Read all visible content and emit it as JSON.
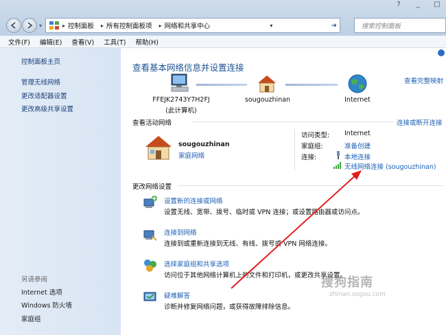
{
  "window": {
    "controls": [
      "?",
      "_",
      "□"
    ]
  },
  "address": {
    "crumbs": [
      "控制面板",
      "所有控制面板项",
      "网络和共享中心"
    ],
    "search_placeholder": "搜索控制面板"
  },
  "menu": [
    "文件(F)",
    "编辑(E)",
    "查看(V)",
    "工具(T)",
    "帮助(H)"
  ],
  "sidebar": {
    "home": "控制面板主页",
    "items": [
      "管理无线网络",
      "更改适配器设置",
      "更改高级共享设置"
    ],
    "see_also_heading": "另请参阅",
    "see_also": [
      "Internet 选项",
      "Windows 防火墙",
      "家庭组"
    ]
  },
  "main": {
    "title": "查看基本网络信息并设置连接",
    "full_map": "查看完整映射",
    "map": {
      "computer_name": "FFEJK2743Y7H2FJ",
      "computer_sub": "(此计算机)",
      "network_name": "sougouzhinan",
      "internet_label": "Internet"
    },
    "active": {
      "heading": "查看活动网络",
      "connect_link": "连接或断开连接",
      "network_name": "sougouzhinan",
      "network_type": "家庭网络",
      "access_type_label": "访问类型:",
      "access_type_value": "Internet",
      "homegroup_label": "家庭组:",
      "homegroup_value": "准备创建",
      "connections_label": "连接:",
      "connection_1": "本地连接",
      "connection_2": "无线网络连接 (sougouzhinan)"
    },
    "change": {
      "heading": "更改网络设置",
      "tasks": [
        {
          "title": "设置新的连接或网络",
          "desc": "设置无线、宽带、拨号、临时或 VPN 连接；或设置路由器或访问点。"
        },
        {
          "title": "连接到网络",
          "desc": "连接到或重新连接到无线、有线、拨号或 VPN 网络连接。"
        },
        {
          "title": "选择家庭组和共享选项",
          "desc": "访问位于其他网络计算机上的文件和打印机，或更改共享设置。"
        },
        {
          "title": "疑难解答",
          "desc": "诊断并修复网络问题，或获得故障排除信息。"
        }
      ]
    }
  },
  "watermark": {
    "line1": "搜狗指南",
    "line2": "zhinan.sogou.com"
  },
  "colors": {
    "link": "#1a5fb4",
    "title": "#1c5394",
    "arrow": "#e21b1b"
  }
}
